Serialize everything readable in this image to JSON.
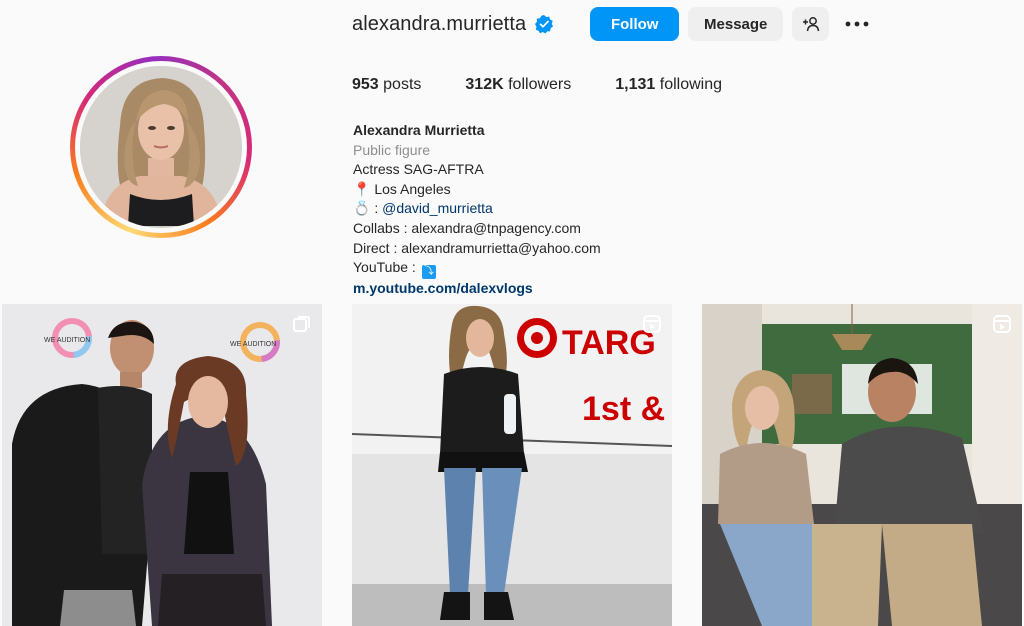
{
  "profile": {
    "username": "alexandra.murrietta",
    "verified_icon": "verified-badge-icon",
    "follow_label": "Follow",
    "message_label": "Message",
    "add_user_icon": "add-user-icon",
    "more_icon": "more-options-icon"
  },
  "stats": [
    {
      "value": "953",
      "label": "posts"
    },
    {
      "value": "312K",
      "label": "followers"
    },
    {
      "value": "1,131",
      "label": "following"
    }
  ],
  "bio": {
    "full_name": "Alexandra Murrietta",
    "category": "Public figure",
    "line1": "Actress SAG-AFTRA",
    "location_icon": "📍",
    "location": "Los Angeles",
    "ring_icon": "💍",
    "partner_prefix": " : ",
    "partner_mention": "@david_murrietta",
    "collabs": "Collabs : alexandra@tnpagency.com",
    "direct": "Direct : alexandramurrietta@yahoo.com",
    "youtube_label": "YouTube : ",
    "youtube_arrow": "⤵",
    "link": "m.youtube.com/dalexvlogs"
  },
  "posts": [
    {
      "type_icon": "carousel-icon",
      "wall_text_1": "WE AUDITION",
      "wall_text_2": "WE AUDITION"
    },
    {
      "type_icon": "reel-icon",
      "wall_text_1": "TARG",
      "wall_text_2": "1st &"
    },
    {
      "type_icon": "reel-icon"
    }
  ],
  "colors": {
    "accent": "#0095f6",
    "verified": "#0095f6",
    "link": "#00376b"
  }
}
